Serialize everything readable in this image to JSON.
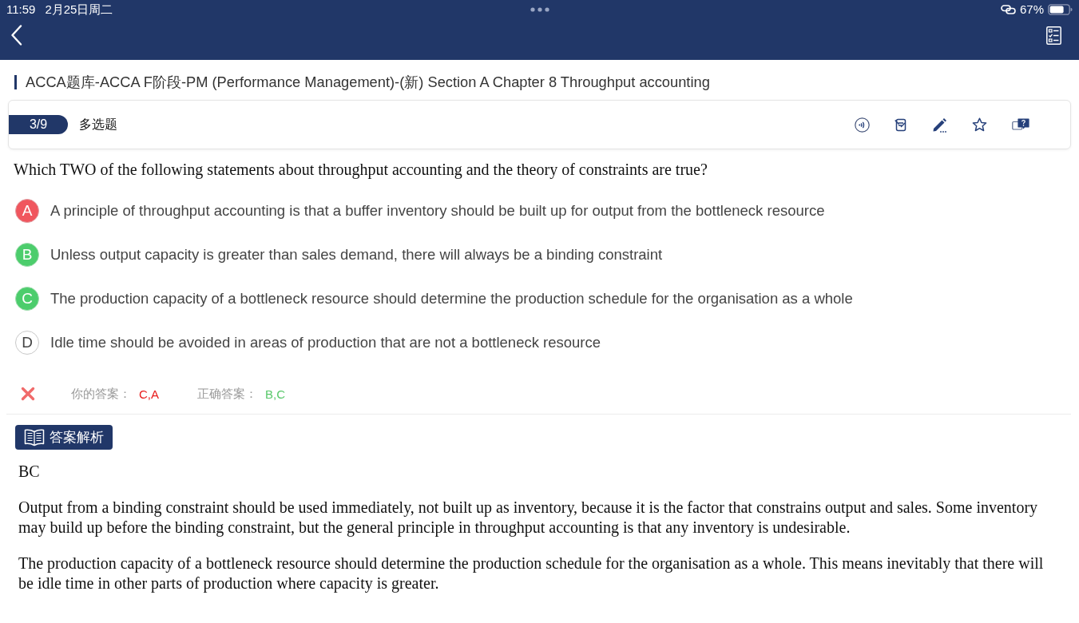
{
  "status_bar": {
    "time": "11:59",
    "date": "2月25日周二",
    "battery": "67%"
  },
  "breadcrumb": "ACCA题库-ACCA F阶段-PM (Performance Management)-(新) Section A Chapter 8 Throughput accounting",
  "question_card": {
    "progress": "3/9",
    "type": "多选题"
  },
  "question": "Which TWO of the following statements about throughput accounting and the theory of constraints are true?",
  "options": [
    {
      "letter": "A",
      "text": "A principle of throughput accounting is that a buffer inventory should be built up for output from the bottleneck resource",
      "kind": "wrong"
    },
    {
      "letter": "B",
      "text": "Unless output capacity is greater than sales demand, there will always be a binding constraint",
      "kind": "correct"
    },
    {
      "letter": "C",
      "text": "The production capacity of a bottleneck resource should determine the production schedule for the organisation as a whole",
      "kind": "correct"
    },
    {
      "letter": "D",
      "text": "Idle time should be avoided in areas of production that are not a bottleneck resource",
      "kind": "plain"
    }
  ],
  "result": {
    "correct": false,
    "your_answer_label": "你的答案：",
    "your_answer": "C,A",
    "correct_answer_label": "正确答案：",
    "correct_answer": "B,C"
  },
  "explanation": {
    "title": "答案解析",
    "paragraphs": [
      "BC",
      "Output from a binding constraint should be used immediately, not built up as inventory, because it is the factor that constrains output and sales. Some inventory may build up before the binding constraint, but the general principle in throughput accounting is that any inventory is undesirable.",
      "The production capacity of a bottleneck resource should determine the production schedule for the organisation as a whole. This means inevitably that there will be idle time in other parts of production where capacity is greater."
    ]
  }
}
